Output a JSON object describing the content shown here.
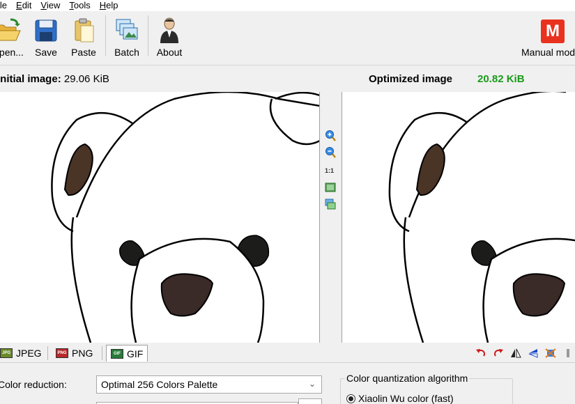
{
  "menu": {
    "file": {
      "accel": "F",
      "rest": "ile"
    },
    "edit": {
      "accel": "E",
      "rest": "dit"
    },
    "view": {
      "accel": "V",
      "rest": "iew"
    },
    "tools": {
      "accel": "T",
      "rest": "ools"
    },
    "help": {
      "accel": "H",
      "rest": "elp"
    }
  },
  "toolbar": {
    "open_label": "Open...",
    "save_label": "Save",
    "paste_label": "Paste",
    "batch_label": "Batch",
    "about_label": "About",
    "mode_label": "Manual mode",
    "mode_glyph": "M"
  },
  "images": {
    "initial_label": "Initial image:",
    "initial_size": "29.06 KiB",
    "optimized_label": "Optimized image",
    "optimized_size": "20.82 KiB"
  },
  "zoom": {
    "one_to_one": "1:1"
  },
  "tabs": [
    {
      "label": "JPEG",
      "icon_text": "JPG"
    },
    {
      "label": "PNG",
      "icon_text": "PNG"
    },
    {
      "label": "GIF",
      "icon_text": "GIF"
    }
  ],
  "options": {
    "color_reduction_label": "Color reduction:",
    "color_reduction_value": "Optimal 256 Colors Palette",
    "quantization_title": "Color quantization algorithm",
    "quantization_option": "Xiaolin Wu color (fast)"
  },
  "colors": {
    "accent_red": "#e8321e",
    "green_size": "#1a9b1a"
  }
}
